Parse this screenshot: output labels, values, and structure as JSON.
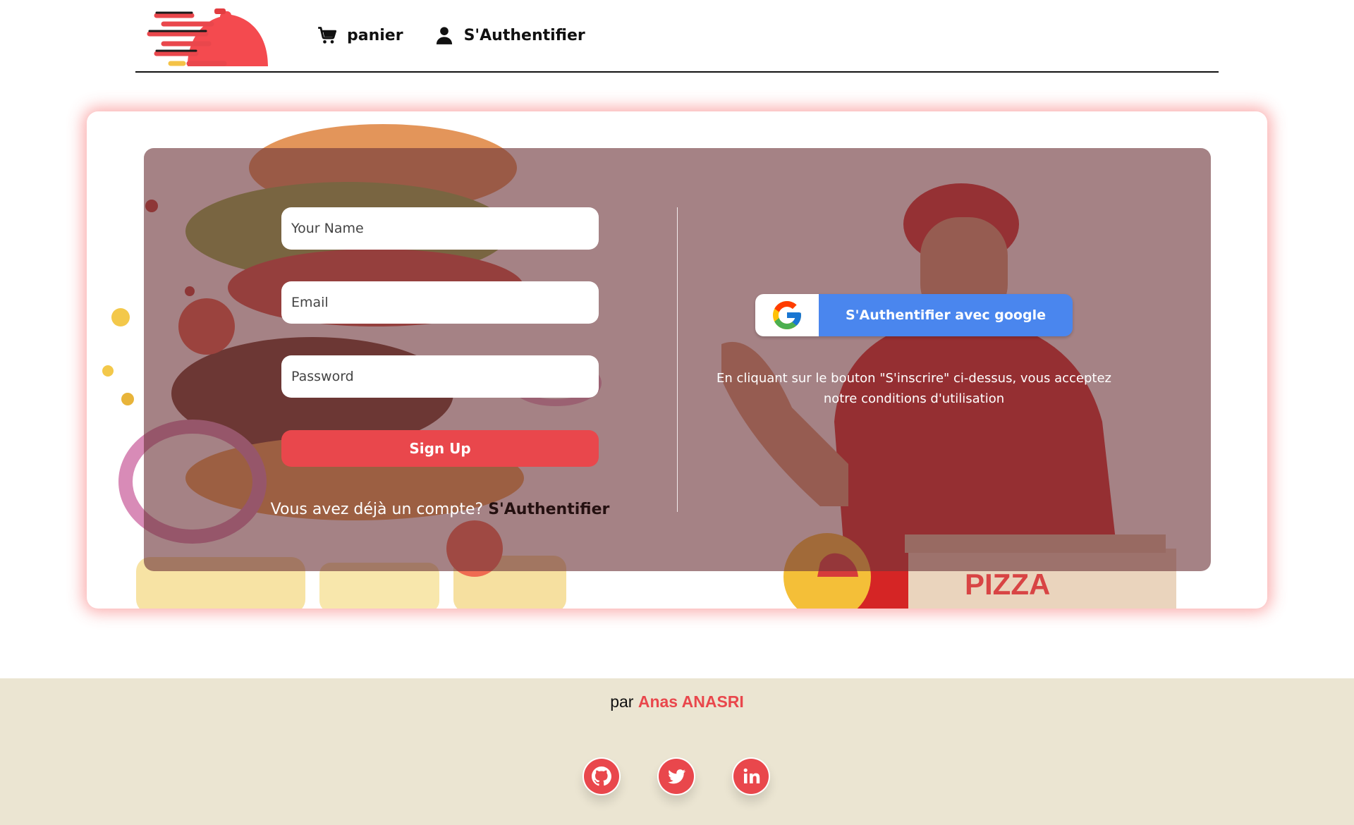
{
  "header": {
    "nav": {
      "cart_label": "panier",
      "login_label": "S'Authentifier"
    }
  },
  "signup_form": {
    "name_placeholder": "Your Name",
    "email_placeholder": "Email",
    "password_placeholder": "Password",
    "submit_label": "Sign Up",
    "login_prompt": "Vous avez déjà un compte?",
    "login_link": "S'Authentifier"
  },
  "google_auth": {
    "button_label": "S'Authentifier avec google",
    "terms_line1": "En cliquant sur le bouton \"S'inscrire\" ci-dessus, vous acceptez",
    "terms_line2": "notre conditions d'utilisation"
  },
  "footer": {
    "by_label": "par",
    "author": "Anas ANASRI",
    "socials": [
      "github-icon",
      "twitter-icon",
      "linkedin-icon"
    ]
  },
  "colors": {
    "accent": "#e9474c",
    "google_blue": "#4a86ee",
    "footer_bg": "#ebe5d2",
    "panel_overlay": "#6e363a"
  }
}
